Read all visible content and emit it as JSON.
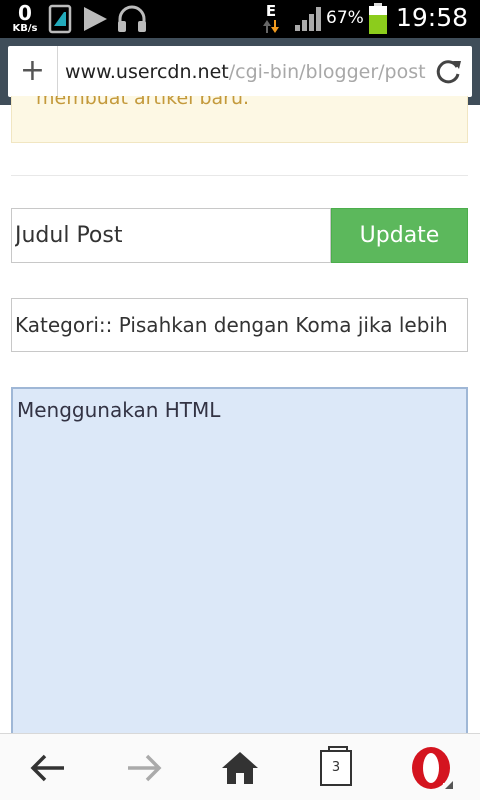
{
  "status_bar": {
    "kb_value": "0",
    "kb_unit": "KB/s",
    "network_type": "E",
    "battery_percent": "67%",
    "time": "19:58",
    "icons": [
      "sim-card-icon",
      "play-icon",
      "headphones-icon",
      "data-transfer-icon",
      "signal-icon",
      "battery-icon"
    ]
  },
  "browser": {
    "new_tab_label": "+",
    "url_host": "www.usercdn.net",
    "url_path": "/cgi-bin/blogger/post",
    "reload_icon": "reload-icon"
  },
  "form": {
    "notice_text": "membuat artikel baru.",
    "title_placeholder": "Judul Post",
    "update_label": "Update",
    "category_placeholder": "Kategori:: Pisahkan dengan Koma jika lebih",
    "body_placeholder": "Menggunakan HTML"
  },
  "bottom_nav": {
    "tab_count": "3",
    "icons": [
      "back-arrow-icon",
      "forward-arrow-icon",
      "home-icon",
      "tabs-icon",
      "opera-icon"
    ]
  },
  "colors": {
    "status_bar": "#000000",
    "url_bar": "#3f4d59",
    "update_button": "#5cb85c",
    "notice_bg": "#fdf8e4",
    "notice_text": "#c49a3c",
    "editor_bg": "#dce8f8",
    "opera_red": "#d4141f",
    "battery_green": "#8ccc1c"
  }
}
